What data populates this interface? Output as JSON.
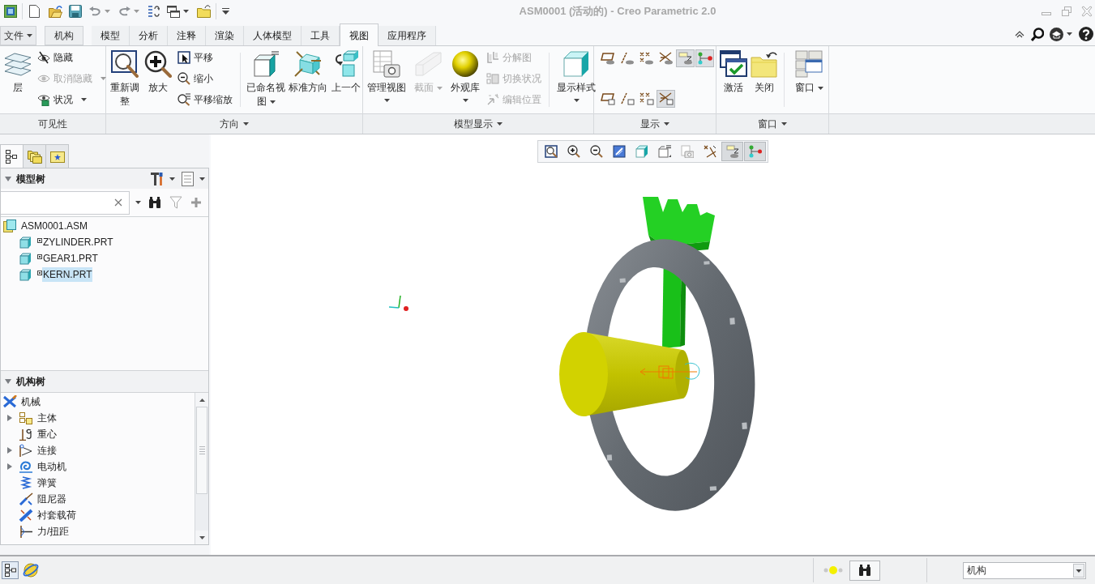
{
  "window": {
    "title": "ASM0001 (活动的) - Creo Parametric 2.0"
  },
  "ribbon_tabs": [
    {
      "label": "文件",
      "kind": "menu",
      "selected": false
    },
    {
      "label": "机构",
      "kind": "mode",
      "selected": false
    },
    {
      "label": "模型",
      "kind": "tab",
      "selected": false
    },
    {
      "label": "分析",
      "kind": "tab",
      "selected": false
    },
    {
      "label": "注释",
      "kind": "tab",
      "selected": false
    },
    {
      "label": "渲染",
      "kind": "tab",
      "selected": false
    },
    {
      "label": "人体模型",
      "kind": "tab",
      "selected": false
    },
    {
      "label": "工具",
      "kind": "tab",
      "selected": false
    },
    {
      "label": "视图",
      "kind": "tab",
      "selected": true
    },
    {
      "label": "应用程序",
      "kind": "tab",
      "selected": false
    }
  ],
  "ribbon_groups": [
    {
      "label": "可见性",
      "menu": false,
      "items": [
        {
          "kind": "large",
          "label": "层",
          "menu": false,
          "disabled": false
        },
        {
          "kind": "stack",
          "buttons": [
            {
              "label": "隐藏",
              "menu": false,
              "disabled": false
            },
            {
              "label": "取消隐藏",
              "menu": true,
              "disabled": true
            },
            {
              "label": "状况",
              "menu": true,
              "disabled": false
            }
          ]
        }
      ]
    },
    {
      "label": "方向",
      "menu": true,
      "items": [
        {
          "kind": "large",
          "label": "重新调整",
          "menu": false,
          "disabled": false
        },
        {
          "kind": "large",
          "label": "放大",
          "menu": false,
          "disabled": false
        },
        {
          "kind": "stack",
          "buttons": [
            {
              "label": "平移",
              "menu": false,
              "disabled": false
            },
            {
              "label": "缩小",
              "menu": false,
              "disabled": false
            },
            {
              "label": "平移缩放",
              "menu": false,
              "disabled": false
            }
          ]
        },
        {
          "kind": "separator"
        },
        {
          "kind": "large",
          "label": "已命名视图",
          "menu": true,
          "disabled": false
        },
        {
          "kind": "large",
          "label": "标准方向",
          "menu": false,
          "disabled": false
        },
        {
          "kind": "large",
          "label": "上一个",
          "menu": false,
          "disabled": false
        }
      ]
    },
    {
      "label": "模型显示",
      "menu": true,
      "items": [
        {
          "kind": "large",
          "label": "管理视图",
          "menu": true,
          "disabled": false
        },
        {
          "kind": "large",
          "label": "截面",
          "menu": true,
          "disabled": true
        },
        {
          "kind": "large",
          "label": "外观库",
          "menu": true,
          "disabled": false
        },
        {
          "kind": "stack",
          "buttons": [
            {
              "label": "分解图",
              "menu": false,
              "disabled": true
            },
            {
              "label": "切换状况",
              "menu": false,
              "disabled": true
            },
            {
              "label": "编辑位置",
              "menu": false,
              "disabled": true
            }
          ]
        },
        {
          "kind": "separator"
        },
        {
          "kind": "large",
          "label": "显示样式",
          "menu": true,
          "disabled": false
        }
      ]
    },
    {
      "label": "显示",
      "menu": true,
      "items": [
        {
          "kind": "toggle_grid",
          "rows": [
            {
              "buttons": [
                {
                  "on": false
                },
                {
                  "on": false
                },
                {
                  "on": false
                },
                {
                  "on": false
                },
                {
                  "on": true
                },
                {
                  "on": true
                }
              ]
            },
            {
              "buttons": [
                {
                  "on": false
                },
                {
                  "on": false
                },
                {
                  "on": false
                },
                {
                  "on": true
                }
              ]
            }
          ]
        }
      ]
    },
    {
      "label": "窗口",
      "menu": true,
      "items": [
        {
          "kind": "large",
          "label": "激活",
          "menu": false,
          "disabled": false
        },
        {
          "kind": "large",
          "label": "关闭",
          "menu": false,
          "disabled": false
        },
        {
          "kind": "separator"
        },
        {
          "kind": "large",
          "label": "窗口",
          "menu": true,
          "disabled": false
        }
      ]
    }
  ],
  "navigator_tabs": [
    {
      "selected": true
    },
    {
      "selected": false
    },
    {
      "selected": false
    }
  ],
  "model_tree": {
    "title": "模型树",
    "expanded": true,
    "items": [
      {
        "label": "ASM0001.ASM",
        "selected": false,
        "children": [
          {
            "label": "ZYLINDER.PRT",
            "selected": false
          },
          {
            "label": "GEAR1.PRT",
            "selected": false
          },
          {
            "label": "KERN.PRT",
            "selected": true
          }
        ]
      }
    ]
  },
  "mechanism_tree": {
    "title": "机构树",
    "expanded": true,
    "items": [
      {
        "label": "机械",
        "children": [
          {
            "label": "主体",
            "expanded": false
          },
          {
            "label": "重心"
          },
          {
            "label": "连接",
            "expanded": false
          },
          {
            "label": "电动机",
            "expanded": false
          },
          {
            "label": "弹簧"
          },
          {
            "label": "阻尼器"
          },
          {
            "label": "衬套载荷"
          },
          {
            "label": "力/扭距"
          }
        ]
      }
    ]
  },
  "view_toolbar": [
    {
      "on": false
    },
    {
      "on": false
    },
    {
      "on": false
    },
    {
      "on": false
    },
    {
      "on": false
    },
    {
      "on": false
    },
    {
      "on": false
    },
    {
      "on": false
    },
    {
      "on": true
    },
    {
      "on": true
    }
  ],
  "status_bar": {
    "filter": {
      "value": "机构"
    }
  }
}
